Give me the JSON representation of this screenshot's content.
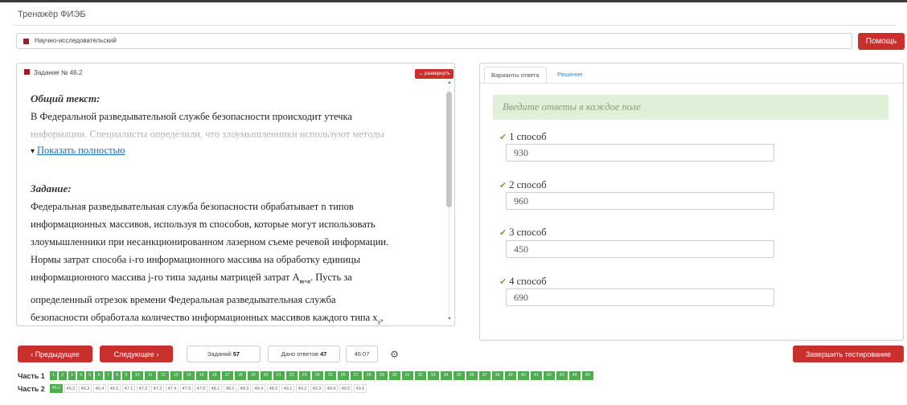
{
  "app_title": "Тренажёр ФИЭБ",
  "direction": "Научно-исследовательский",
  "help_label": "Помощь",
  "task": {
    "number": "Задание № 46.2",
    "expand_label": "↔ развернуть",
    "general_title": "Общий текст:",
    "general_line1": "В Федеральной разведывательной службе безопасности происходит утечка",
    "general_line2": "информации. Специалисты определили, что злоумышленники используют методы",
    "show_more": "Показать полностью",
    "task_title": "Задание:",
    "lines": [
      "Федеральная разведывательная служба безопасности обрабатывает n типов",
      "информационных массивов, используя m способов, которые могут использовать",
      "злоумышленники при несанкционированном лазерном съеме речевой информации.",
      "Нормы затрат способа i-го информационного массива на обработку единицы",
      "информационного массива j-го типа заданы матрицей затрат A",
      "определенный отрезок времени Федеральная разведывательная служба",
      "безопасности обработала количество информационных массивов каждого типа x"
    ],
    "matrix_sub": "m×n",
    "line5_tail": ". Пусть за",
    "x_sub": "ij",
    "line7_tail": ","
  },
  "answers": {
    "tab_variants": "Варианты ответа",
    "tab_solution": "Решение",
    "hint": "Введите ответы в каждое поле",
    "fields": [
      {
        "label": "1 способ",
        "value": "930"
      },
      {
        "label": "2 способ",
        "value": "960"
      },
      {
        "label": "3 способ",
        "value": "450"
      },
      {
        "label": "4 способ",
        "value": "690"
      }
    ]
  },
  "nav": {
    "prev_label": "‹ Предыдущее",
    "next_label": "Следующее ›",
    "tasks_label": "Заданий",
    "tasks_count": "57",
    "answered_label": "Дано ответов",
    "answered_count": "47",
    "timer": "46:07",
    "finish_label": "Завершить тестирование"
  },
  "parts": {
    "part1_label": "Часть 1",
    "part1_items": [
      "1",
      "2",
      "3",
      "4",
      "5",
      "6",
      "7",
      "8",
      "9",
      "10",
      "11",
      "12",
      "13",
      "14",
      "15",
      "16",
      "17",
      "18",
      "19",
      "20",
      "21",
      "22",
      "23",
      "24",
      "25",
      "26",
      "27",
      "28",
      "29",
      "30",
      "31",
      "32",
      "33",
      "34",
      "35",
      "36",
      "37",
      "38",
      "39",
      "40",
      "41",
      "42",
      "43",
      "44",
      "45"
    ],
    "part2_label": "Часть 2",
    "part2_items": [
      {
        "label": "46.1",
        "done": true
      },
      {
        "label": "46.2",
        "done": false
      },
      {
        "label": "46.3",
        "done": false
      },
      {
        "label": "46.4",
        "done": false
      },
      {
        "label": "46.5",
        "done": false
      },
      {
        "label": "47.1",
        "done": false
      },
      {
        "label": "47.2",
        "done": false
      },
      {
        "label": "47.3",
        "done": false
      },
      {
        "label": "47.4",
        "done": false
      },
      {
        "label": "47.5",
        "done": false
      },
      {
        "label": "47.6",
        "done": false
      },
      {
        "label": "48.1",
        "done": false
      },
      {
        "label": "48.2",
        "done": false
      },
      {
        "label": "48.3",
        "done": false
      },
      {
        "label": "48.4",
        "done": false
      },
      {
        "label": "48.5",
        "done": false
      },
      {
        "label": "49.1",
        "done": false
      },
      {
        "label": "49.2",
        "done": false
      },
      {
        "label": "49.3",
        "done": false
      },
      {
        "label": "49.4",
        "done": false
      },
      {
        "label": "49.5",
        "done": false
      },
      {
        "label": "49.6",
        "done": false
      }
    ]
  },
  "colors": {
    "accent_red": "#c9302c",
    "success_green": "#4cae4c",
    "hint_bg": "#dff0d8"
  }
}
